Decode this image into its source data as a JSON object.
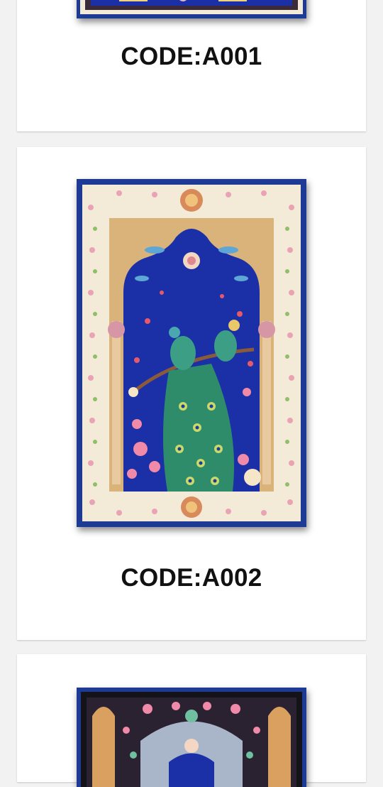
{
  "products": [
    {
      "code": "CODE:A001"
    },
    {
      "code": "CODE:A002"
    },
    {
      "code": ""
    }
  ],
  "colors": {
    "page_bg": "#f2f2f2",
    "card_bg": "#ffffff",
    "rug_border_blue": "#1d3a94",
    "rug_field_blue": "#1b2fa6",
    "rug_cream": "#f4ead8",
    "rug_gold": "#d9b37a"
  },
  "icons": [
    "peacock-carpet-image",
    "carpet-image"
  ]
}
